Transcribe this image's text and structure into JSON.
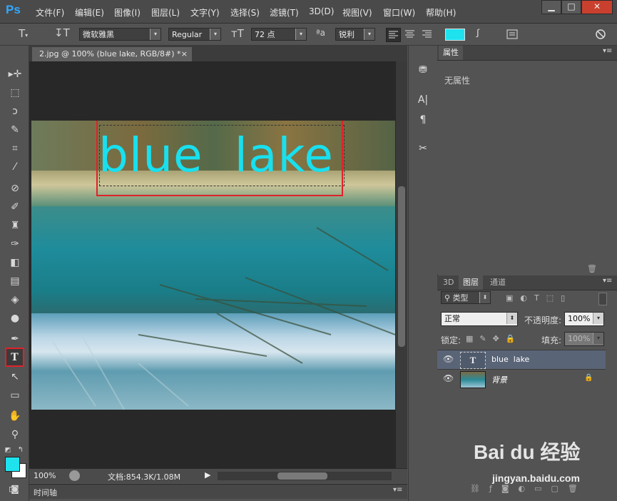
{
  "app": {
    "logo": "Ps"
  },
  "menu": [
    "文件(F)",
    "编辑(E)",
    "图像(I)",
    "图层(L)",
    "文字(Y)",
    "选择(S)",
    "滤镜(T)",
    "3D(D)",
    "视图(V)",
    "窗口(W)",
    "帮助(H)"
  ],
  "window_controls": {
    "minimize": "▁",
    "maximize": "□",
    "close": "✕"
  },
  "options": {
    "font_family": "微软雅黑",
    "font_style": "Regular",
    "font_size": "72 点",
    "antialias_glyph": "ªa",
    "antialias": "锐利",
    "text_color": "#1ee3ef"
  },
  "document": {
    "tab_title": "2.jpg @ 100% (blue lake, RGB/8#) *",
    "canvas_text": "blue  lake",
    "zoom": "100%",
    "doc_size": "文档:854.3K/1.08M",
    "timeline_label": "时间轴"
  },
  "properties": {
    "title": "属性",
    "empty_text": "无属性"
  },
  "layers_panel": {
    "tabs": [
      "3D",
      "图层",
      "通道"
    ],
    "filter_kind": "类型",
    "blend_mode": "正常",
    "opacity_label": "不透明度:",
    "opacity_value": "100%",
    "lock_label": "锁定:",
    "fill_label": "填充:",
    "fill_value": "100%",
    "layers": [
      {
        "name": "blue  lake",
        "type": "text",
        "selected": true
      },
      {
        "name": "背景",
        "type": "image",
        "locked": true
      }
    ]
  },
  "watermark": {
    "brand": "Bai du 经验",
    "url": "jingyan.baidu.com"
  },
  "colors": {
    "foreground": "#1ee3ef",
    "background": "#ffffff",
    "highlight_box": "#e0222a"
  }
}
